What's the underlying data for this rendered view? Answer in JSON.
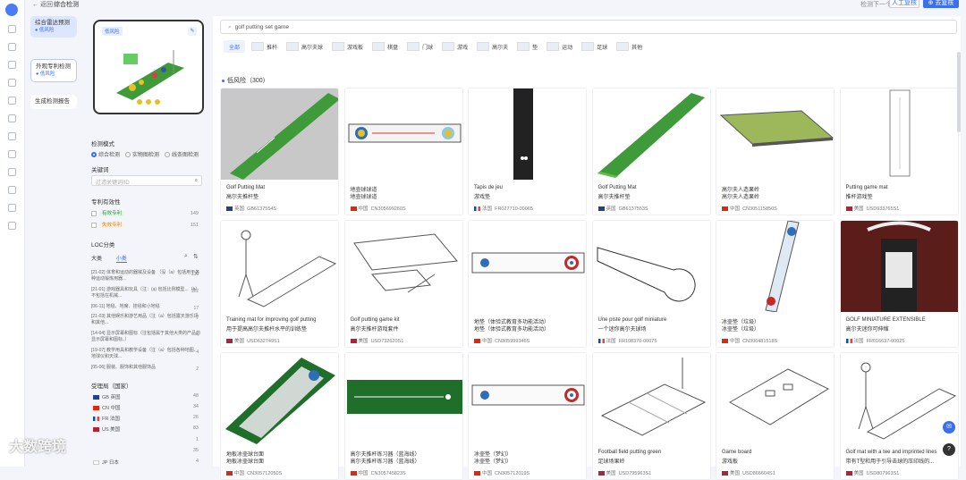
{
  "app": {
    "back": "← 返回",
    "title": "综合检测",
    "next": "检测下一个产品",
    "btn_review": "人工复核",
    "btn_download": "⊕ 去复核"
  },
  "sidenav": [
    {
      "label": "综合雷达预测",
      "sub": "● 低风险"
    },
    {
      "label": "外观专利检测",
      "sub": "● 低风险"
    },
    {
      "label": "生成检测报告",
      "sub": ""
    }
  ],
  "filter": {
    "image_tag": "低风险",
    "mode_title": "检测模式",
    "modes": [
      "综合检测",
      "实物图检测",
      "线条图检测"
    ],
    "kw_title": "关键词",
    "kw_placeholder": "过滤关键词/ID",
    "validity_title": "专利有效性",
    "validity": [
      {
        "label": "有效专利",
        "count": "149"
      },
      {
        "label": "失效专利",
        "count": "151"
      }
    ],
    "loc_title": "LOC分类",
    "loc_tabs": [
      "大类",
      "小类"
    ],
    "loc_items": [
      {
        "text": "[21-02] 体育和运动的器械及设备 （没（a）包括用于各种运动锻炼用器...",
        "count": "136"
      },
      {
        "text": "[21-01] 游戏器具和玩具（注：(a) 包括比例模型...（b）不包括在机械...",
        "count": "122"
      },
      {
        "text": "[06-11] 地毯、地席、挂毯和小地毯",
        "count": "17"
      },
      {
        "text": "[21-03] 其他娱乐和游艺用品（注（a）包括露天游乐场和其他...",
        "count": "7"
      },
      {
        "text": "[14-04] 显示屏幕和图标（注包括属于其他大类的产品的显示屏幕和图标。）",
        "count": "4"
      },
      {
        "text": "[19-07] 教学用具和教学设备（注（a）包括各种地图、地球仪和天球...",
        "count": "4"
      },
      {
        "text": "[05-06] 服装、服饰和其他服饰品",
        "count": "2"
      }
    ],
    "country_title": "受理局（国家）",
    "countries": [
      {
        "code": "GB",
        "name": "英国",
        "count": "48"
      },
      {
        "code": "CN",
        "name": "中国",
        "count": "34"
      },
      {
        "code": "FR",
        "name": "法国",
        "count": "26"
      },
      {
        "code": "US",
        "name": "美国",
        "count": "83"
      },
      {
        "code": "",
        "name": "",
        "count": "1"
      },
      {
        "code": "",
        "name": "",
        "count": "35"
      },
      {
        "code": "JP",
        "name": "日本",
        "count": "4"
      }
    ]
  },
  "search": {
    "value": "golf putting set game"
  },
  "categories": [
    "全部",
    "推杆",
    "高尔夫球",
    "游戏板",
    "棋盘",
    "门球",
    "游戏",
    "高尔夫",
    "垫",
    "运动",
    "足球",
    "其他"
  ],
  "risk_heading": "低风险（300）",
  "cards": [
    {
      "t1": "Golf Putting Mat",
      "t2": "高尔夫推杆垫",
      "flag": "英国",
      "id": "GB6137554S",
      "kind": "greenmat"
    },
    {
      "t1": "地壶球球道",
      "t2": "地壶球球道",
      "flag": "中国",
      "id": "CN305699260S",
      "kind": "curlingtrack"
    },
    {
      "t1": "Tapis de jeu",
      "t2": "游戏垫",
      "flag": "法国",
      "id": "FR027710-00065",
      "kind": "darkmat"
    },
    {
      "t1": "Golf Putting Mat",
      "t2": "高尔夫推杆垫",
      "flag": "英国",
      "id": "GB6137553S",
      "kind": "greenmat2"
    },
    {
      "t1": "高尔夫人造果岭",
      "t2": "高尔夫人造果岭",
      "flag": "中国",
      "id": "CN305115850S",
      "kind": "isogreen"
    },
    {
      "t1": "Putting game mat",
      "t2": "推杆游戏垫",
      "flag": "美国",
      "id": "USD933765S1",
      "kind": "linemat"
    },
    {
      "t1": "Training mat for improving golf putting",
      "t2": "用于提高高尔夫推杆水平的训练垫",
      "flag": "美国",
      "id": "USD632749S1",
      "kind": "sketchman"
    },
    {
      "t1": "Golf putting game kit",
      "t2": "高尔夫推杆游戏套件",
      "flag": "美国",
      "id": "USD732620S1",
      "kind": "kit"
    },
    {
      "t1": "地垫（体验式教育多功能活动）",
      "t2": "地垫（体验式教育多功能活动）",
      "flag": "中国",
      "id": "CN305999346S",
      "kind": "curlrow"
    },
    {
      "t1": "Une piste pour golf miniature",
      "t2": "一个迷你高尔夫球场",
      "flag": "法国",
      "id": "FR108370-00075",
      "kind": "minigolf"
    },
    {
      "t1": "冰壶垫（垃圾）",
      "t2": "冰壶垫（垃圾）",
      "flag": "中国",
      "id": "CN306481518S",
      "kind": "diagcurl"
    },
    {
      "t1": "GOLF MINIATURE EXTENSIBLE",
      "t2": "高尔夫迷你可伸缩",
      "flag": "法国",
      "id": "FR016637-00025",
      "kind": "photomat"
    },
    {
      "t1": "地板冰壶球台面",
      "t2": "地板冰壶球台面",
      "flag": "中国",
      "id": "CN305712050S",
      "kind": "greencurl"
    },
    {
      "t1": "高尔夫推杆练习器（蓝海线）",
      "t2": "高尔夫推杆练习器（蓝海线）",
      "flag": "中国",
      "id": "CN305745823S",
      "kind": "darkgreen"
    },
    {
      "t1": "冰壶垫（梦幻）",
      "t2": "冰壶垫（梦幻）",
      "flag": "中国",
      "id": "CN305712019S",
      "kind": "curlrow2"
    },
    {
      "t1": "Football field putting green",
      "t2": "足球场果岭",
      "flag": "美国",
      "id": "USD795963S1",
      "kind": "field"
    },
    {
      "t1": "Game board",
      "t2": "游戏板",
      "flag": "美国",
      "id": "USD866604S1",
      "kind": "board"
    },
    {
      "t1": "Golf mat with a tee and imprinted lines",
      "t2": "带有T型和用于引导击球的压印线的...",
      "flag": "美国",
      "id": "USD807963S1",
      "kind": "sketchman2"
    }
  ],
  "colors": {
    "accent": "#3a6ff0",
    "green": "#3f9b3a",
    "darkgreen": "#1f6f2a"
  },
  "watermark": "大数跨境"
}
